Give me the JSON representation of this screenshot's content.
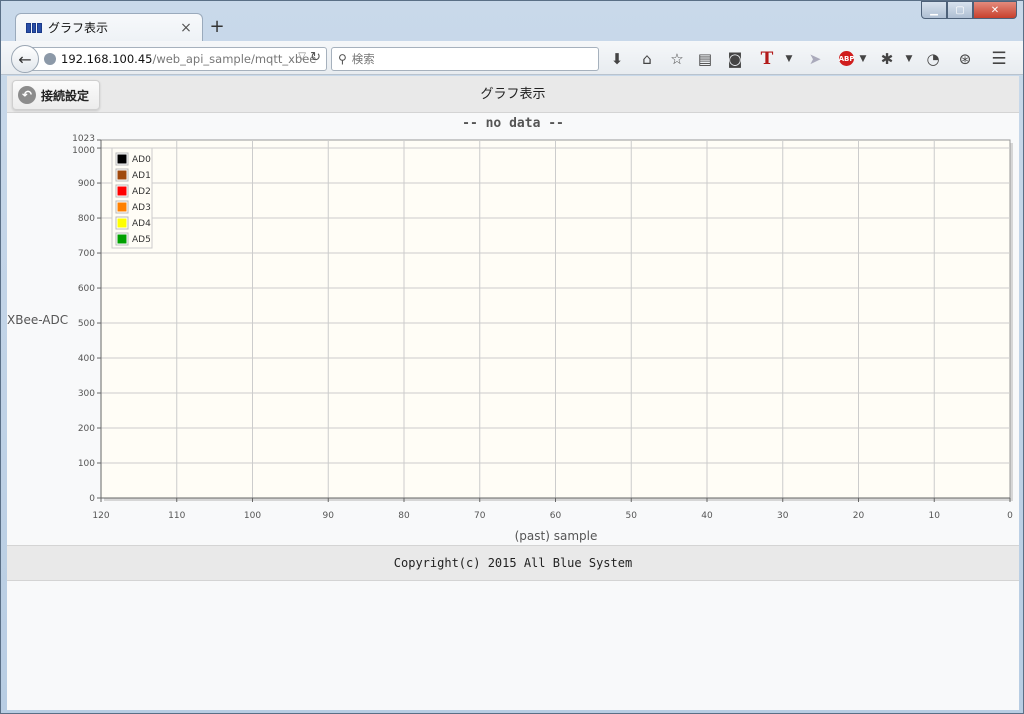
{
  "browser": {
    "tab_title": "グラフ表示",
    "new_tab_label": "+",
    "url_host": "192.168.100.45",
    "url_path": "/web_api_sample/mqtt_xbee",
    "search_placeholder": "検索"
  },
  "header": {
    "connect_button_label": "接続設定",
    "page_title": "グラフ表示"
  },
  "chart_data": {
    "type": "line",
    "title": "-- no data --",
    "xlabel": "(past) sample",
    "ylabel": "XBee-ADC",
    "xlim": [
      120,
      0
    ],
    "ylim": [
      0,
      1023
    ],
    "x_ticks": [
      120,
      110,
      100,
      90,
      80,
      70,
      60,
      50,
      40,
      30,
      20,
      10,
      0
    ],
    "y_ticks": [
      0,
      100,
      200,
      300,
      400,
      500,
      600,
      700,
      800,
      900,
      1000,
      1023
    ],
    "grid": true,
    "legend_position": "top-left",
    "plot_background": "#fffdf6",
    "series": [
      {
        "name": "AD0",
        "color": "#000000",
        "values": []
      },
      {
        "name": "AD1",
        "color": "#a0490c",
        "values": []
      },
      {
        "name": "AD2",
        "color": "#ff0000",
        "values": []
      },
      {
        "name": "AD3",
        "color": "#ff8000",
        "values": []
      },
      {
        "name": "AD4",
        "color": "#ffff00",
        "values": []
      },
      {
        "name": "AD5",
        "color": "#00a000",
        "values": []
      }
    ]
  },
  "footer": {
    "copyright": "Copyright(c) 2015 All Blue System"
  }
}
